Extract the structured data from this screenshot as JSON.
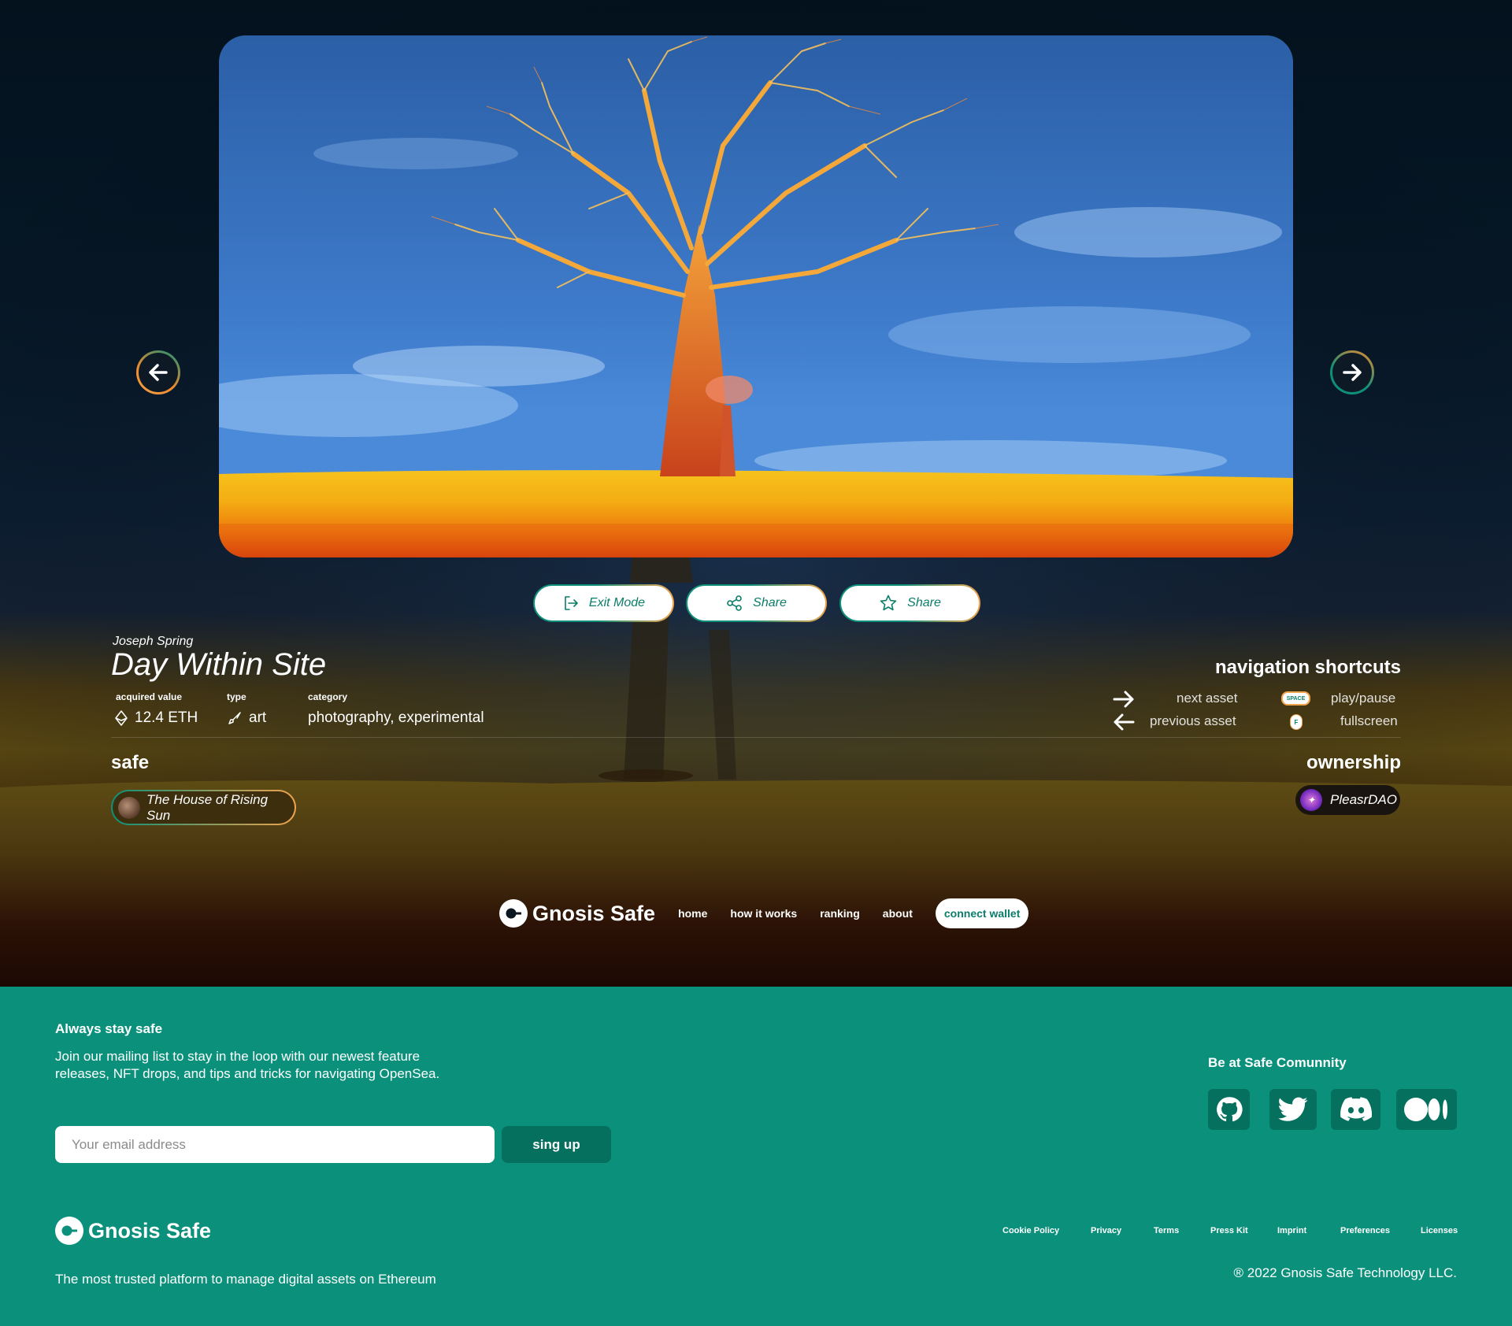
{
  "artwork": {
    "artist": "Joseph Spring",
    "title": "Day Within Site",
    "acquired_value_label": "acquired value",
    "acquired_value": "12.4 ETH",
    "type_label": "type",
    "type_value": "art",
    "category_label": "category",
    "category_value": "photography, experimental"
  },
  "actions": {
    "exit_label": "Exit Mode",
    "share_label": "Share",
    "favorite_label": "Share"
  },
  "shortcuts": {
    "title": "navigation shortcuts",
    "next_label": "next asset",
    "previous_label": "previous asset",
    "play_label": "play/pause",
    "fullscreen_label": "fullscreen",
    "space_key": "SPACE",
    "f_key": "F"
  },
  "safe": {
    "title": "safe",
    "name": "The House of Rising Sun"
  },
  "ownership": {
    "title": "ownership",
    "owner": "PleasrDAO"
  },
  "hero_nav": {
    "brand": "Gnosis Safe",
    "links": [
      "home",
      "how it works",
      "ranking",
      "about"
    ],
    "connect_label": "connect wallet"
  },
  "footer": {
    "heading": "Always stay safe",
    "text": "Join our mailing list to stay in the loop with our newest feature releases, NFT drops, and tips and tricks for navigating OpenSea.",
    "email_placeholder": "Your email address",
    "signup_label": "sing up",
    "community_title": "Be at Safe Comunnity",
    "social_icons": [
      "github-icon",
      "twitter-icon",
      "discord-icon",
      "medium-icon"
    ],
    "brand": "Gnosis Safe",
    "tagline": "The most trusted platform to manage digital assets on Ethereum",
    "links": [
      "Cookie Policy",
      "Privacy",
      "Terms",
      "Press Kit",
      "Imprint",
      "Preferences",
      "Licenses"
    ],
    "copyright": "® 2022 Gnosis Safe Technology LLC."
  },
  "colors": {
    "brand_teal": "#0b917b",
    "dark_teal": "#06705f",
    "accent_orange": "#f0a44c"
  }
}
